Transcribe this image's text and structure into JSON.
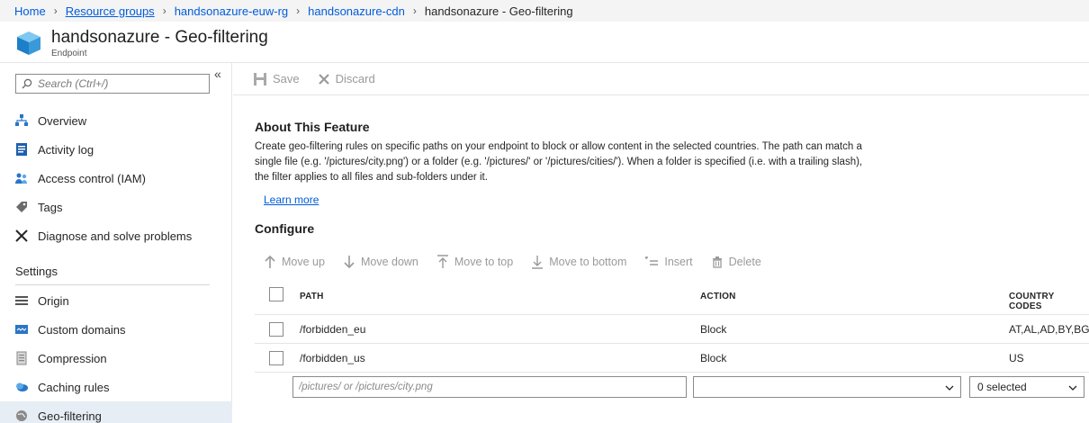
{
  "breadcrumb": {
    "items": [
      "Home",
      "Resource groups",
      "handsonazure-euw-rg",
      "handsonazure-cdn"
    ],
    "current": "handsonazure - Geo-filtering"
  },
  "header": {
    "title": "handsonazure - Geo-filtering",
    "subtitle": "Endpoint",
    "icon": "endpoint-cube-icon"
  },
  "sidebar": {
    "search_placeholder": "Search (Ctrl+/)",
    "collapse_glyph": "«",
    "items": [
      {
        "label": "Overview",
        "icon": "overview-icon"
      },
      {
        "label": "Activity log",
        "icon": "activity-log-icon"
      },
      {
        "label": "Access control (IAM)",
        "icon": "iam-icon"
      },
      {
        "label": "Tags",
        "icon": "tag-icon"
      },
      {
        "label": "Diagnose and solve problems",
        "icon": "wrench-icon"
      }
    ],
    "section_label": "Settings",
    "settings_items": [
      {
        "label": "Origin",
        "icon": "origin-icon"
      },
      {
        "label": "Custom domains",
        "icon": "custom-domains-icon"
      },
      {
        "label": "Compression",
        "icon": "compression-icon"
      },
      {
        "label": "Caching rules",
        "icon": "caching-rules-icon"
      },
      {
        "label": "Geo-filtering",
        "icon": "globe-icon",
        "active": true
      }
    ]
  },
  "toolbar": {
    "save_label": "Save",
    "discard_label": "Discard"
  },
  "about": {
    "heading": "About This Feature",
    "description": "Create geo-filtering rules on specific paths on your endpoint to block or allow content in the selected countries. The path can match a single file (e.g. '/pictures/city.png') or a folder (e.g. '/pictures/' or '/pictures/cities/'). When a folder is specified (i.e. with a trailing slash), the filter applies to all files and sub-folders under it.",
    "learn_more": "Learn more"
  },
  "configure": {
    "heading": "Configure",
    "commands": {
      "move_up": "Move up",
      "move_down": "Move down",
      "move_to_top": "Move to top",
      "move_to_bottom": "Move to bottom",
      "insert": "Insert",
      "delete": "Delete"
    },
    "columns": {
      "path": "PATH",
      "action": "ACTION",
      "country_codes": "COUNTRY CODES"
    },
    "rows": [
      {
        "path": "/forbidden_eu",
        "action": "Block",
        "country_codes": "AT,AL,AD,BY,BG,"
      },
      {
        "path": "/forbidden_us",
        "action": "Block",
        "country_codes": "US"
      }
    ],
    "new_row": {
      "path_placeholder": "/pictures/ or /pictures/city.png",
      "action_value": "",
      "country_value": "0 selected"
    }
  },
  "colors": {
    "link": "#015cda",
    "disabled": "#9a9a9a",
    "active_nav": "#e7edf5"
  }
}
